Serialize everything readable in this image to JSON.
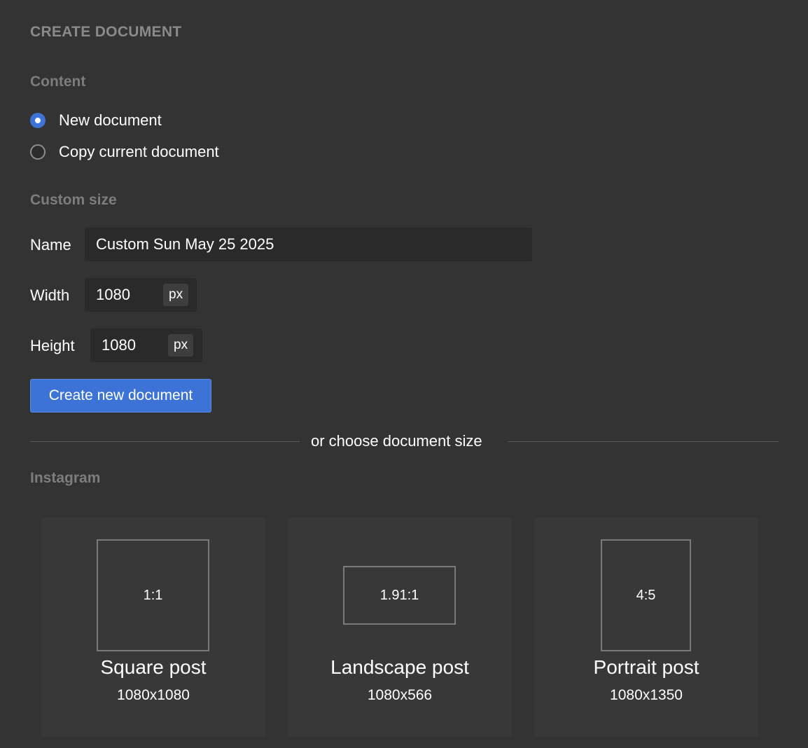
{
  "header": {
    "title": "CREATE DOCUMENT"
  },
  "content": {
    "label": "Content",
    "options": [
      {
        "label": "New document",
        "checked": true
      },
      {
        "label": "Copy current document",
        "checked": false
      }
    ]
  },
  "custom_size": {
    "label": "Custom size",
    "name_label": "Name",
    "name_value": "Custom Sun May 25 2025",
    "width_label": "Width",
    "width_value": "1080",
    "width_unit": "px",
    "height_label": "Height",
    "height_value": "1080",
    "height_unit": "px",
    "create_button": "Create new document"
  },
  "divider": {
    "text": "or choose document size"
  },
  "instagram": {
    "label": "Instagram",
    "presets": [
      {
        "ratio": "1:1",
        "name": "Square post",
        "dims": "1080x1080"
      },
      {
        "ratio": "1.91:1",
        "name": "Landscape post",
        "dims": "1080x566"
      },
      {
        "ratio": "4:5",
        "name": "Portrait post",
        "dims": "1080x1350"
      }
    ]
  },
  "colors": {
    "background": "#333333",
    "accent": "#3d73d6",
    "card": "#383838",
    "input": "#2a2a2a"
  }
}
